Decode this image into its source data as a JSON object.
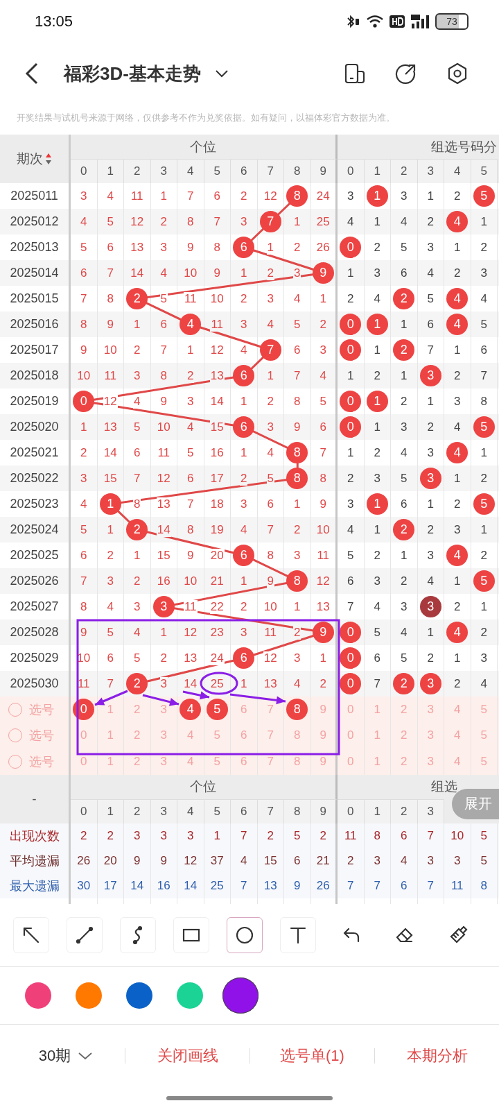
{
  "status_bar": {
    "time": "13:05",
    "battery": "73"
  },
  "header": {
    "title": "福彩3D-基本走势"
  },
  "notice": "开奖结果与试机号来源于网络，仅供参考不作为兑奖依据。如有疑问，以福体彩官方数据为准。",
  "table": {
    "period_label": "期次",
    "group_a_title": "个位",
    "group_b_title": "组选号码分",
    "digits_a": [
      "0",
      "1",
      "2",
      "3",
      "4",
      "5",
      "6",
      "7",
      "8",
      "9"
    ],
    "digits_b": [
      "0",
      "1",
      "2",
      "3",
      "4",
      "5"
    ],
    "rows": [
      {
        "period": "2025011",
        "ones": [
          "3",
          "4",
          "11",
          "1",
          "7",
          "6",
          "2",
          "12",
          "8",
          "24"
        ],
        "ones_ball": [
          false,
          false,
          false,
          false,
          false,
          false,
          false,
          false,
          true,
          false
        ],
        "group": [
          "3",
          "1",
          "3",
          "1",
          "2",
          "5"
        ],
        "group_ball": [
          false,
          true,
          false,
          false,
          false,
          true
        ],
        "group_repeat": [
          false,
          false,
          false,
          false,
          false,
          false
        ]
      },
      {
        "period": "2025012",
        "ones": [
          "4",
          "5",
          "12",
          "2",
          "8",
          "7",
          "3",
          "7",
          "1",
          "25"
        ],
        "ones_ball": [
          false,
          false,
          false,
          false,
          false,
          false,
          false,
          true,
          false,
          false
        ],
        "group": [
          "4",
          "1",
          "4",
          "2",
          "4",
          "1"
        ],
        "group_ball": [
          false,
          false,
          false,
          false,
          true,
          false
        ],
        "group_repeat": [
          false,
          false,
          false,
          false,
          false,
          false
        ]
      },
      {
        "period": "2025013",
        "ones": [
          "5",
          "6",
          "13",
          "3",
          "9",
          "8",
          "6",
          "1",
          "2",
          "26"
        ],
        "ones_ball": [
          false,
          false,
          false,
          false,
          false,
          false,
          true,
          false,
          false,
          false
        ],
        "group": [
          "0",
          "2",
          "5",
          "3",
          "1",
          "2"
        ],
        "group_ball": [
          true,
          false,
          false,
          false,
          false,
          false
        ],
        "group_repeat": [
          false,
          false,
          false,
          false,
          false,
          false
        ]
      },
      {
        "period": "2025014",
        "ones": [
          "6",
          "7",
          "14",
          "4",
          "10",
          "9",
          "1",
          "2",
          "3",
          "9"
        ],
        "ones_ball": [
          false,
          false,
          false,
          false,
          false,
          false,
          false,
          false,
          false,
          true
        ],
        "group": [
          "1",
          "3",
          "6",
          "4",
          "2",
          "3"
        ],
        "group_ball": [
          false,
          false,
          false,
          false,
          false,
          false
        ],
        "group_repeat": [
          false,
          false,
          false,
          false,
          false,
          false
        ]
      },
      {
        "period": "2025015",
        "ones": [
          "7",
          "8",
          "2",
          "5",
          "11",
          "10",
          "2",
          "3",
          "4",
          "1"
        ],
        "ones_ball": [
          false,
          false,
          true,
          false,
          false,
          false,
          false,
          false,
          false,
          false
        ],
        "group": [
          "2",
          "4",
          "2",
          "5",
          "4",
          "4"
        ],
        "group_ball": [
          false,
          false,
          true,
          false,
          true,
          false
        ],
        "group_repeat": [
          false,
          false,
          false,
          false,
          false,
          false
        ]
      },
      {
        "period": "2025016",
        "ones": [
          "8",
          "9",
          "1",
          "6",
          "4",
          "11",
          "3",
          "4",
          "5",
          "2"
        ],
        "ones_ball": [
          false,
          false,
          false,
          false,
          true,
          false,
          false,
          false,
          false,
          false
        ],
        "group": [
          "0",
          "1",
          "1",
          "6",
          "4",
          "5"
        ],
        "group_ball": [
          true,
          true,
          false,
          false,
          true,
          false
        ],
        "group_repeat": [
          false,
          false,
          false,
          false,
          false,
          false
        ]
      },
      {
        "period": "2025017",
        "ones": [
          "9",
          "10",
          "2",
          "7",
          "1",
          "12",
          "4",
          "7",
          "6",
          "3"
        ],
        "ones_ball": [
          false,
          false,
          false,
          false,
          false,
          false,
          false,
          true,
          false,
          false
        ],
        "group": [
          "0",
          "1",
          "2",
          "7",
          "1",
          "6"
        ],
        "group_ball": [
          true,
          false,
          true,
          false,
          false,
          false
        ],
        "group_repeat": [
          false,
          false,
          false,
          false,
          false,
          false
        ]
      },
      {
        "period": "2025018",
        "ones": [
          "10",
          "11",
          "3",
          "8",
          "2",
          "13",
          "6",
          "1",
          "7",
          "4"
        ],
        "ones_ball": [
          false,
          false,
          false,
          false,
          false,
          false,
          true,
          false,
          false,
          false
        ],
        "group": [
          "1",
          "2",
          "1",
          "3",
          "2",
          "7"
        ],
        "group_ball": [
          false,
          false,
          false,
          true,
          false,
          false
        ],
        "group_repeat": [
          false,
          false,
          false,
          false,
          false,
          false
        ]
      },
      {
        "period": "2025019",
        "ones": [
          "0",
          "12",
          "4",
          "9",
          "3",
          "14",
          "1",
          "2",
          "8",
          "5"
        ],
        "ones_ball": [
          true,
          false,
          false,
          false,
          false,
          false,
          false,
          false,
          false,
          false
        ],
        "group": [
          "0",
          "1",
          "2",
          "1",
          "3",
          "8"
        ],
        "group_ball": [
          true,
          true,
          false,
          false,
          false,
          false
        ],
        "group_repeat": [
          false,
          false,
          false,
          false,
          false,
          false
        ]
      },
      {
        "period": "2025020",
        "ones": [
          "1",
          "13",
          "5",
          "10",
          "4",
          "15",
          "6",
          "3",
          "9",
          "6"
        ],
        "ones_ball": [
          false,
          false,
          false,
          false,
          false,
          false,
          true,
          false,
          false,
          false
        ],
        "group": [
          "0",
          "1",
          "3",
          "2",
          "4",
          "5"
        ],
        "group_ball": [
          true,
          false,
          false,
          false,
          false,
          true
        ],
        "group_repeat": [
          false,
          false,
          false,
          false,
          false,
          false
        ]
      },
      {
        "period": "2025021",
        "ones": [
          "2",
          "14",
          "6",
          "11",
          "5",
          "16",
          "1",
          "4",
          "8",
          "7"
        ],
        "ones_ball": [
          false,
          false,
          false,
          false,
          false,
          false,
          false,
          false,
          true,
          false
        ],
        "group": [
          "1",
          "2",
          "4",
          "3",
          "4",
          "1"
        ],
        "group_ball": [
          false,
          false,
          false,
          false,
          true,
          false
        ],
        "group_repeat": [
          false,
          false,
          false,
          false,
          false,
          false
        ]
      },
      {
        "period": "2025022",
        "ones": [
          "3",
          "15",
          "7",
          "12",
          "6",
          "17",
          "2",
          "5",
          "8",
          "8"
        ],
        "ones_ball": [
          false,
          false,
          false,
          false,
          false,
          false,
          false,
          false,
          true,
          false
        ],
        "group": [
          "2",
          "3",
          "5",
          "3",
          "1",
          "2"
        ],
        "group_ball": [
          false,
          false,
          false,
          true,
          false,
          false
        ],
        "group_repeat": [
          false,
          false,
          false,
          false,
          false,
          false
        ]
      },
      {
        "period": "2025023",
        "ones": [
          "4",
          "1",
          "8",
          "13",
          "7",
          "18",
          "3",
          "6",
          "1",
          "9"
        ],
        "ones_ball": [
          false,
          true,
          false,
          false,
          false,
          false,
          false,
          false,
          false,
          false
        ],
        "group": [
          "3",
          "1",
          "6",
          "1",
          "2",
          "5"
        ],
        "group_ball": [
          false,
          true,
          false,
          false,
          false,
          true
        ],
        "group_repeat": [
          false,
          false,
          false,
          false,
          false,
          false
        ]
      },
      {
        "period": "2025024",
        "ones": [
          "5",
          "1",
          "2",
          "14",
          "8",
          "19",
          "4",
          "7",
          "2",
          "10"
        ],
        "ones_ball": [
          false,
          false,
          true,
          false,
          false,
          false,
          false,
          false,
          false,
          false
        ],
        "group": [
          "4",
          "1",
          "2",
          "2",
          "3",
          "1"
        ],
        "group_ball": [
          false,
          false,
          true,
          false,
          false,
          false
        ],
        "group_repeat": [
          false,
          false,
          false,
          false,
          false,
          false
        ]
      },
      {
        "period": "2025025",
        "ones": [
          "6",
          "2",
          "1",
          "15",
          "9",
          "20",
          "6",
          "8",
          "3",
          "11"
        ],
        "ones_ball": [
          false,
          false,
          false,
          false,
          false,
          false,
          true,
          false,
          false,
          false
        ],
        "group": [
          "5",
          "2",
          "1",
          "3",
          "4",
          "2"
        ],
        "group_ball": [
          false,
          false,
          false,
          false,
          true,
          false
        ],
        "group_repeat": [
          false,
          false,
          false,
          false,
          false,
          false
        ]
      },
      {
        "period": "2025026",
        "ones": [
          "7",
          "3",
          "2",
          "16",
          "10",
          "21",
          "1",
          "9",
          "8",
          "12"
        ],
        "ones_ball": [
          false,
          false,
          false,
          false,
          false,
          false,
          false,
          false,
          true,
          false
        ],
        "group": [
          "6",
          "3",
          "2",
          "4",
          "1",
          "5"
        ],
        "group_ball": [
          false,
          false,
          false,
          false,
          false,
          true
        ],
        "group_repeat": [
          false,
          false,
          false,
          false,
          false,
          false
        ]
      },
      {
        "period": "2025027",
        "ones": [
          "8",
          "4",
          "3",
          "3",
          "11",
          "22",
          "2",
          "10",
          "1",
          "13"
        ],
        "ones_ball": [
          false,
          false,
          false,
          true,
          false,
          false,
          false,
          false,
          false,
          false
        ],
        "group": [
          "7",
          "4",
          "3",
          "3",
          "2",
          "1"
        ],
        "group_ball": [
          false,
          false,
          false,
          true,
          false,
          false
        ],
        "group_repeat": [
          false,
          false,
          false,
          true,
          false,
          false
        ]
      },
      {
        "period": "2025028",
        "ones": [
          "9",
          "5",
          "4",
          "1",
          "12",
          "23",
          "3",
          "11",
          "2",
          "9"
        ],
        "ones_ball": [
          false,
          false,
          false,
          false,
          false,
          false,
          false,
          false,
          false,
          true
        ],
        "group": [
          "0",
          "5",
          "4",
          "1",
          "4",
          "2"
        ],
        "group_ball": [
          true,
          false,
          false,
          false,
          true,
          false
        ],
        "group_repeat": [
          false,
          false,
          false,
          false,
          false,
          false
        ]
      },
      {
        "period": "2025029",
        "ones": [
          "10",
          "6",
          "5",
          "2",
          "13",
          "24",
          "6",
          "12",
          "3",
          "1"
        ],
        "ones_ball": [
          false,
          false,
          false,
          false,
          false,
          false,
          true,
          false,
          false,
          false
        ],
        "group": [
          "0",
          "6",
          "5",
          "2",
          "1",
          "3"
        ],
        "group_ball": [
          true,
          false,
          false,
          false,
          false,
          false
        ],
        "group_repeat": [
          false,
          false,
          false,
          false,
          false,
          false
        ]
      },
      {
        "period": "2025030",
        "ones": [
          "11",
          "7",
          "2",
          "3",
          "14",
          "25",
          "1",
          "13",
          "4",
          "2"
        ],
        "ones_ball": [
          false,
          false,
          true,
          false,
          false,
          false,
          false,
          false,
          false,
          false
        ],
        "group": [
          "0",
          "7",
          "2",
          "3",
          "2",
          "4"
        ],
        "group_ball": [
          true,
          false,
          true,
          true,
          false,
          false
        ],
        "group_repeat": [
          false,
          false,
          false,
          false,
          false,
          false
        ]
      }
    ]
  },
  "picker": {
    "rows": [
      {
        "label": "选号",
        "checked": false,
        "digits_a": [
          "0",
          "1",
          "2",
          "3",
          "4",
          "5",
          "6",
          "7",
          "8",
          "9"
        ],
        "selected_a": [
          true,
          false,
          false,
          false,
          true,
          true,
          false,
          false,
          true,
          false
        ],
        "digits_b": [
          "0",
          "1",
          "2",
          "3",
          "4",
          "5"
        ],
        "selected_b": [
          false,
          false,
          false,
          false,
          false,
          false
        ]
      },
      {
        "label": "选号",
        "checked": false,
        "digits_a": [
          "0",
          "1",
          "2",
          "3",
          "4",
          "5",
          "6",
          "7",
          "8",
          "9"
        ],
        "selected_a": [
          false,
          false,
          false,
          false,
          false,
          false,
          false,
          false,
          false,
          false
        ],
        "digits_b": [
          "0",
          "1",
          "2",
          "3",
          "4",
          "5"
        ],
        "selected_b": [
          false,
          false,
          false,
          false,
          false,
          false
        ]
      },
      {
        "label": "选号",
        "checked": false,
        "digits_a": [
          "0",
          "1",
          "2",
          "3",
          "4",
          "5",
          "6",
          "7",
          "8",
          "9"
        ],
        "selected_a": [
          false,
          false,
          false,
          false,
          false,
          false,
          false,
          false,
          false,
          false
        ],
        "digits_b": [
          "0",
          "1",
          "2",
          "3",
          "4",
          "5"
        ],
        "selected_b": [
          false,
          false,
          false,
          false,
          false,
          false
        ]
      }
    ]
  },
  "summary": {
    "label": "-",
    "group_a_title": "个位",
    "group_b_title": "组选",
    "digits_a": [
      "0",
      "1",
      "2",
      "3",
      "4",
      "5",
      "6",
      "7",
      "8",
      "9"
    ],
    "digits_b": [
      "0",
      "1",
      "2",
      "3"
    ],
    "expand_button": "展开",
    "rows": [
      {
        "kind": "count",
        "label": "出现次数",
        "values": [
          "2",
          "2",
          "3",
          "3",
          "3",
          "1",
          "7",
          "2",
          "5",
          "2",
          "11",
          "8",
          "6",
          "7",
          "10",
          "5"
        ]
      },
      {
        "kind": "average",
        "label": "平均遗漏",
        "values": [
          "26",
          "20",
          "9",
          "9",
          "12",
          "37",
          "4",
          "15",
          "6",
          "21",
          "2",
          "3",
          "4",
          "3",
          "3",
          "5"
        ]
      },
      {
        "kind": "max",
        "label": "最大遗漏",
        "values": [
          "30",
          "17",
          "14",
          "16",
          "14",
          "25",
          "7",
          "13",
          "9",
          "26",
          "7",
          "7",
          "6",
          "7",
          "11",
          "8"
        ]
      }
    ]
  },
  "tools": [
    {
      "kind": "arrow",
      "boxed": true,
      "selected": false
    },
    {
      "kind": "line",
      "boxed": true,
      "selected": false
    },
    {
      "kind": "curve",
      "boxed": true,
      "selected": false
    },
    {
      "kind": "rectangle",
      "boxed": true,
      "selected": false
    },
    {
      "kind": "ellipse",
      "boxed": true,
      "selected": true
    },
    {
      "kind": "text",
      "boxed": true,
      "selected": false
    },
    {
      "kind": "undo",
      "boxed": false,
      "selected": false
    },
    {
      "kind": "eraser",
      "boxed": false,
      "selected": false
    },
    {
      "kind": "clear",
      "boxed": false,
      "selected": false
    }
  ],
  "colors": [
    {
      "color": "#f0407a",
      "selected": false
    },
    {
      "color": "#ff7800",
      "selected": false
    },
    {
      "color": "#0a62c8",
      "selected": false
    },
    {
      "color": "#1ad394",
      "selected": false
    },
    {
      "color": "#9012e8",
      "selected": true
    }
  ],
  "bottom_bar": {
    "period_select": "30期",
    "actions": [
      "关闭画线",
      "选号单(1)",
      "本期分析"
    ]
  }
}
